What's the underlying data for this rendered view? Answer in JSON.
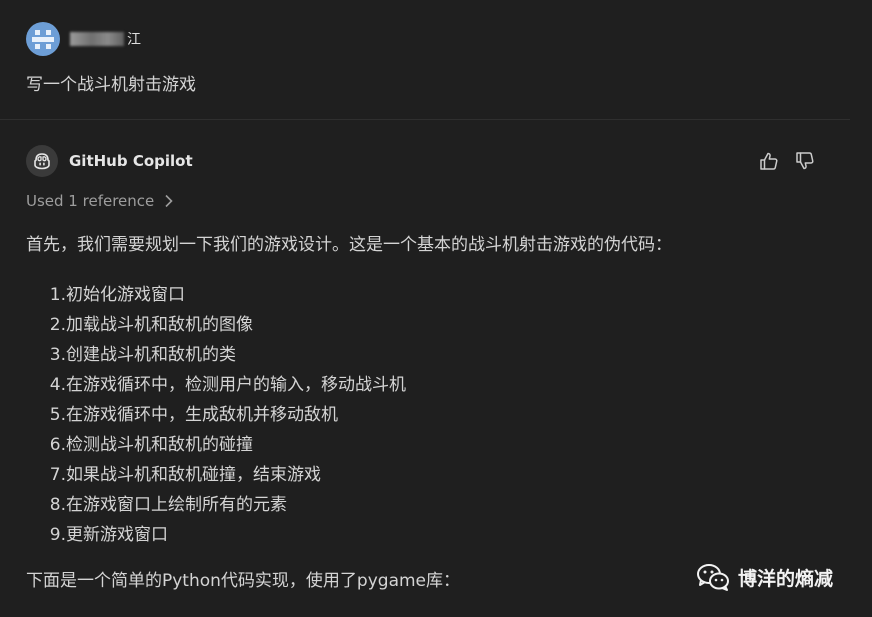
{
  "request": {
    "username_visible": "江",
    "message": "写一个战斗机射击游戏"
  },
  "response": {
    "assistant_name": "GitHub Copilot",
    "used_reference": "Used 1 reference",
    "intro": "首先，我们需要规划一下我们的游戏设计。这是一个基本的战斗机射击游戏的伪代码：",
    "steps": [
      {
        "num": "1.",
        "text": "初始化游戏窗口"
      },
      {
        "num": "2.",
        "text": "加载战斗机和敌机的图像"
      },
      {
        "num": "3.",
        "text": "创建战斗机和敌机的类"
      },
      {
        "num": "4.",
        "text": "在游戏循环中，检测用户的输入，移动战斗机"
      },
      {
        "num": "5.",
        "text": "在游戏循环中，生成敌机并移动敌机"
      },
      {
        "num": "6.",
        "text": "检测战斗机和敌机的碰撞"
      },
      {
        "num": "7.",
        "text": "如果战斗机和敌机碰撞，结束游戏"
      },
      {
        "num": "8.",
        "text": "在游戏窗口上绘制所有的元素"
      },
      {
        "num": "9.",
        "text": "更新游戏窗口"
      }
    ],
    "outro": "下面是一个简单的Python代码实现，使用了pygame库："
  },
  "icons": {
    "user_avatar": "pixel-avatar-icon",
    "copilot": "copilot-icon",
    "thumbs_up": "thumbs-up-icon",
    "thumbs_down": "thumbs-down-icon",
    "chevron": "chevron-right-icon",
    "wechat": "wechat-icon"
  },
  "watermark": {
    "text": "博洋的熵减"
  },
  "colors": {
    "background": "#1f1f1f",
    "text": "#d4d4d4",
    "muted": "#9d9d9d",
    "avatar_blue": "#6d9ed6"
  }
}
